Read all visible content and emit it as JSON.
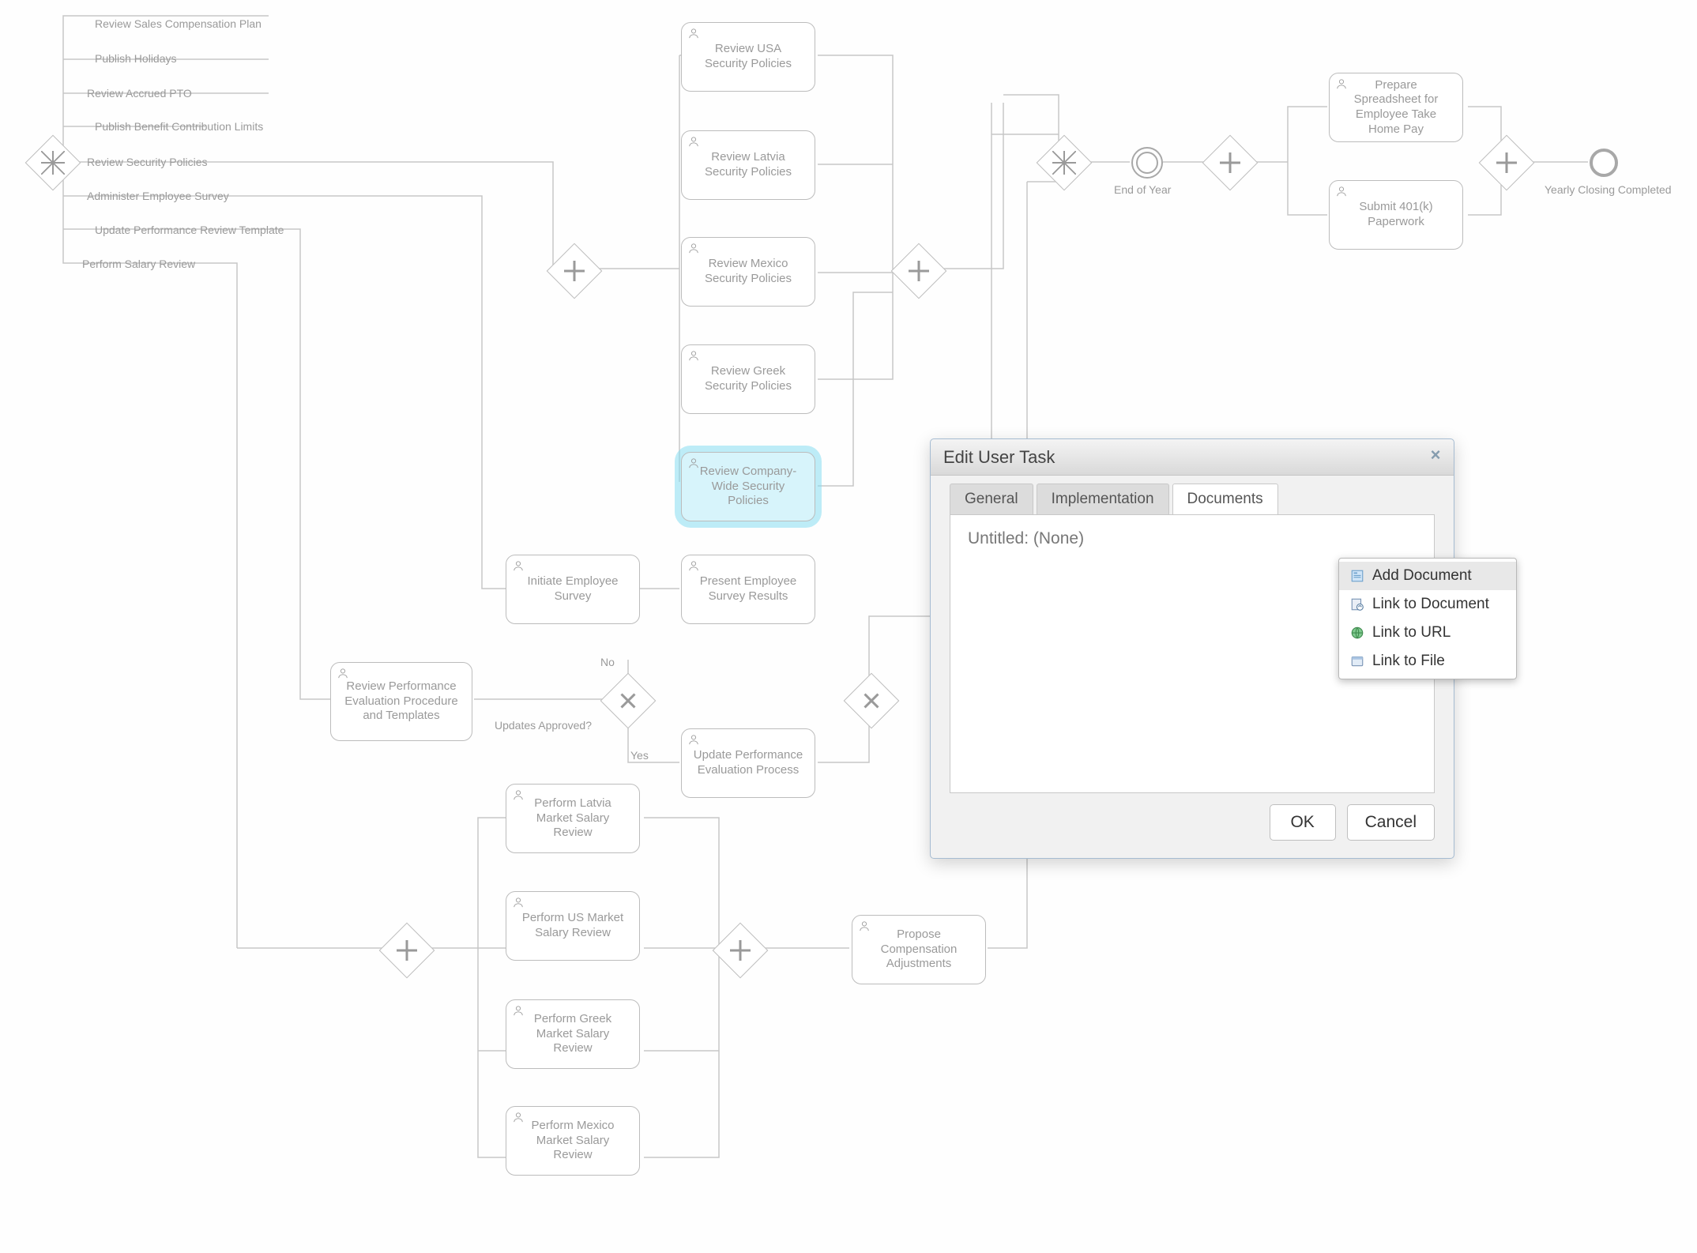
{
  "diagram": {
    "edge_labels": {
      "l1": "Review Sales Compensation Plan",
      "l2": "Publish Holidays",
      "l3": "Review Accrued PTO",
      "l4": "Publish Benefit Contribution Limits",
      "l5": "Review Security Policies",
      "l6": "Administer Employee Survey",
      "l7": "Update Performance Review Template",
      "l8": "Perform Salary Review",
      "updates_q": "Updates Approved?",
      "no": "No",
      "yes": "Yes",
      "end_of_year": "End of Year",
      "closing": "Yearly Closing Completed"
    },
    "tasks": {
      "usa_sec": "Review USA Security Policies",
      "latvia_sec": "Review Latvia Security Policies",
      "mexico_sec": "Review Mexico Security Policies",
      "greek_sec": "Review Greek Security Policies",
      "company_sec": "Review Company-Wide Security Policies",
      "init_survey": "Initiate Employee Survey",
      "present_survey": "Present Employee Survey Results",
      "review_perf": "Review Performance Evaluation Procedure and Templates",
      "update_perf": "Update Performance Evaluation Process",
      "latvia_salary": "Perform Latvia Market Salary Review",
      "us_salary": "Perform US Market Salary Review",
      "greek_salary": "Perform Greek Market Salary Review",
      "mexico_salary": "Perform Mexico Market Salary Review",
      "propose_comp": "Propose Compensation Adjustments",
      "spreadsheet": "Prepare Spreadsheet for Employee Take Home Pay",
      "submit_401k": "Submit 401(k) Paperwork"
    }
  },
  "dialog": {
    "title": "Edit User Task",
    "tabs": {
      "general": "General",
      "implementation": "Implementation",
      "documents": "Documents"
    },
    "active_tab": "documents",
    "panel_text": "Untitled: (None)",
    "ok": "OK",
    "cancel": "Cancel"
  },
  "context_menu": {
    "add_document": "Add Document",
    "link_document": "Link to Document",
    "link_url": "Link to URL",
    "link_file": "Link to File"
  }
}
